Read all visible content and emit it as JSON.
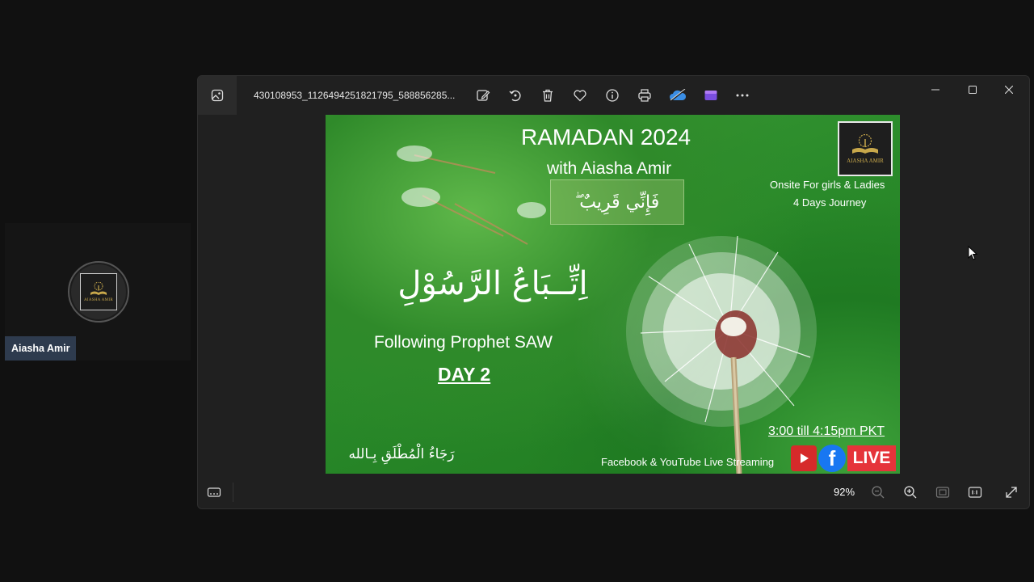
{
  "participant": {
    "name": "Aiasha Amir",
    "logo_brand": "AIASHA AMIR"
  },
  "window": {
    "filename": "430108953_1126494251821795_588856285...",
    "toolbar_icons": [
      "edit-icon",
      "rotate-icon",
      "delete-icon",
      "favorite-icon",
      "info-icon",
      "print-icon",
      "onedrive-icon",
      "clipchamp-icon",
      "more-icon"
    ],
    "window_controls": [
      "minimize-icon",
      "maximize-icon",
      "close-icon"
    ]
  },
  "poster": {
    "title": "RAMADAN 2024",
    "subtitle": "with Aiasha Amir",
    "arabic_verse": "فَإِنِّي قَرِيبٌ ۖ",
    "arabic_main": "اِتِّــبَاعُ الرَّسُوْلِ",
    "english_title": "Following Prophet SAW",
    "day": "DAY 2",
    "arabic_bottom": "رَجَاءُ الْمُطْلَقِ بِـالله",
    "onsite": "Onsite For girls & Ladies",
    "journey": "4 Days Journey",
    "time": "3:00 till 4:15pm PKT",
    "streaming": "Facebook & YouTube Live Streaming",
    "live": "LIVE",
    "fb_letter": "f",
    "logo_brand": "AIASHA AMIR"
  },
  "bottom_bar": {
    "zoom": "92%"
  },
  "colors": {
    "accent_green": "#2f8a2a",
    "name_tag": "#2e3b4e",
    "live_red": "#e5343a",
    "facebook_blue": "#1877f2"
  }
}
